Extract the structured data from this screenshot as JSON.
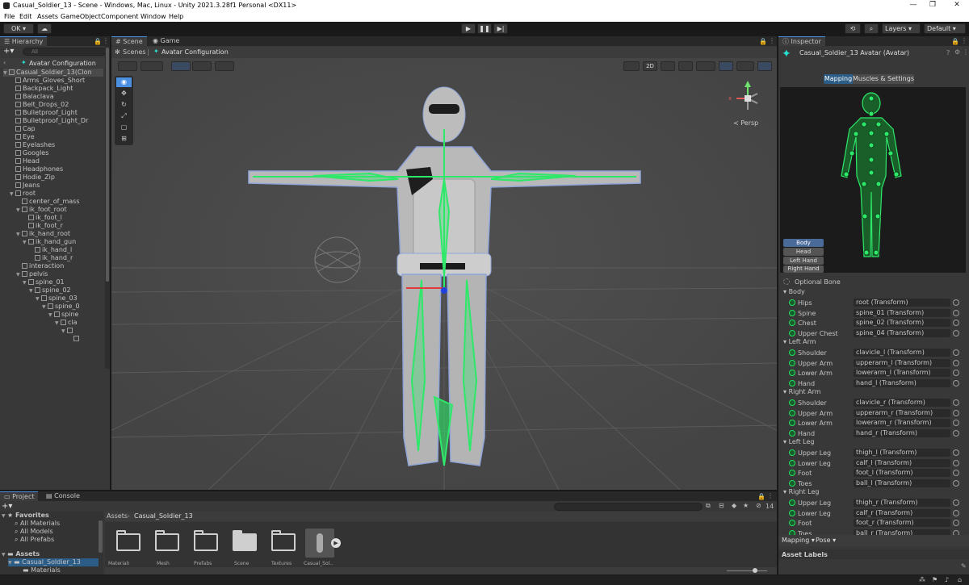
{
  "window": {
    "title": "Casual_Soldier_13 - Scene - Windows, Mac, Linux - Unity 2021.3.28f1 Personal <DX11>",
    "minimize": "—",
    "maximize": "❐",
    "close": "✕"
  },
  "menu": [
    "File",
    "Edit",
    "Assets",
    "GameObject",
    "Component",
    "Window",
    "Help"
  ],
  "toolbar": {
    "account": "OK ▾",
    "layers": "Layers",
    "layout": "Default"
  },
  "hierarchy": {
    "tab": "Hierarchy",
    "search_placeholder": "All",
    "stage": "Avatar Configuration",
    "items": [
      {
        "label": "Casual_Soldier_13(Clon",
        "d": 0,
        "fold": "open"
      },
      {
        "label": "Arms_Gloves_Short",
        "d": 1
      },
      {
        "label": "Backpack_Light",
        "d": 1
      },
      {
        "label": "Balaclava",
        "d": 1
      },
      {
        "label": "Belt_Drops_02",
        "d": 1
      },
      {
        "label": "Bulletproof_Light",
        "d": 1
      },
      {
        "label": "Bulletproof_Light_Dr",
        "d": 1
      },
      {
        "label": "Cap",
        "d": 1
      },
      {
        "label": "Eye",
        "d": 1
      },
      {
        "label": "Eyelashes",
        "d": 1
      },
      {
        "label": "Googles",
        "d": 1
      },
      {
        "label": "Head",
        "d": 1
      },
      {
        "label": "Headphones",
        "d": 1
      },
      {
        "label": "Hodie_Zip",
        "d": 1
      },
      {
        "label": "Jeans",
        "d": 1
      },
      {
        "label": "root",
        "d": 1,
        "fold": "open"
      },
      {
        "label": "center_of_mass",
        "d": 2
      },
      {
        "label": "ik_foot_root",
        "d": 2,
        "fold": "open"
      },
      {
        "label": "ik_foot_l",
        "d": 3
      },
      {
        "label": "ik_foot_r",
        "d": 3
      },
      {
        "label": "ik_hand_root",
        "d": 2,
        "fold": "open"
      },
      {
        "label": "ik_hand_gun",
        "d": 3,
        "fold": "open"
      },
      {
        "label": "ik_hand_l",
        "d": 4
      },
      {
        "label": "ik_hand_r",
        "d": 4
      },
      {
        "label": "interaction",
        "d": 2
      },
      {
        "label": "pelvis",
        "d": 2,
        "fold": "open"
      },
      {
        "label": "spine_01",
        "d": 3,
        "fold": "open"
      },
      {
        "label": "spine_02",
        "d": 4,
        "fold": "open"
      },
      {
        "label": "spine_03",
        "d": 5,
        "fold": "open"
      },
      {
        "label": "spine_0",
        "d": 6,
        "fold": "open"
      },
      {
        "label": "spine",
        "d": 7,
        "fold": "open"
      },
      {
        "label": "cla",
        "d": 8,
        "fold": "open"
      },
      {
        "label": "",
        "d": 9,
        "fold": "open"
      },
      {
        "label": "",
        "d": 10
      }
    ]
  },
  "scene": {
    "tabs": [
      "Scene",
      "Game"
    ],
    "breadcrumb": [
      "Scenes",
      "Avatar Configuration"
    ],
    "mode_2d": "2D",
    "persp": "≺ Persp",
    "gizmo_x": "x"
  },
  "project": {
    "tabs": [
      "Project",
      "Console"
    ],
    "breadcrumb": [
      "Assets",
      "Casual_Soldier_13"
    ],
    "count": "14",
    "favorites": {
      "label": "Favorites",
      "items": [
        "All Materials",
        "All Models",
        "All Prefabs"
      ]
    },
    "tree": [
      {
        "label": "Assets",
        "d": 0
      },
      {
        "label": "Casual_Soldier_13",
        "d": 1
      },
      {
        "label": "Materials",
        "d": 2
      }
    ],
    "assets": [
      "Materials",
      "Mesh",
      "Prefabs",
      "Scene",
      "Textures",
      "Casual_Sol..."
    ]
  },
  "inspector": {
    "tab": "Inspector",
    "object_title": "Casual_Soldier_13 Avatar (Avatar)",
    "tabs": [
      "Mapping",
      "Muscles & Settings"
    ],
    "body_buttons": [
      "Body",
      "Head",
      "Left Hand",
      "Right Hand"
    ],
    "optional_bone": "Optional Bone",
    "groups": [
      {
        "name": "Body",
        "rows": [
          [
            "Hips",
            "root (Transform)"
          ],
          [
            "Spine",
            "spine_01 (Transform)"
          ],
          [
            "Chest",
            "spine_02 (Transform)"
          ],
          [
            "Upper Chest",
            "spine_04 (Transform)"
          ]
        ]
      },
      {
        "name": "Left Arm",
        "rows": [
          [
            "Shoulder",
            "clavicle_l (Transform)"
          ],
          [
            "Upper Arm",
            "upperarm_l (Transform)"
          ],
          [
            "Lower Arm",
            "lowerarm_l (Transform)"
          ],
          [
            "Hand",
            "hand_l (Transform)"
          ]
        ]
      },
      {
        "name": "Right Arm",
        "rows": [
          [
            "Shoulder",
            "clavicle_r (Transform)"
          ],
          [
            "Upper Arm",
            "upperarm_r (Transform)"
          ],
          [
            "Lower Arm",
            "lowerarm_r (Transform)"
          ],
          [
            "Hand",
            "hand_r (Transform)"
          ]
        ]
      },
      {
        "name": "Left Leg",
        "rows": [
          [
            "Upper Leg",
            "thigh_l (Transform)"
          ],
          [
            "Lower Leg",
            "calf_l (Transform)"
          ],
          [
            "Foot",
            "foot_l (Transform)"
          ],
          [
            "Toes",
            "ball_l (Transform)"
          ]
        ]
      },
      {
        "name": "Right Leg",
        "rows": [
          [
            "Upper Leg",
            "thigh_r (Transform)"
          ],
          [
            "Lower Leg",
            "calf_r (Transform)"
          ],
          [
            "Foot",
            "foot_r (Transform)"
          ],
          [
            "Toes",
            "ball_r (Transform)"
          ]
        ]
      }
    ],
    "mapping_menu": "Mapping ▾",
    "pose_menu": "Pose ▾",
    "asset_labels": "Asset Labels"
  },
  "colors": {
    "accent": "#4a8fe0",
    "bone": "#2ee86a",
    "editor_bg": "#383838",
    "scene_bg": "#474747"
  }
}
